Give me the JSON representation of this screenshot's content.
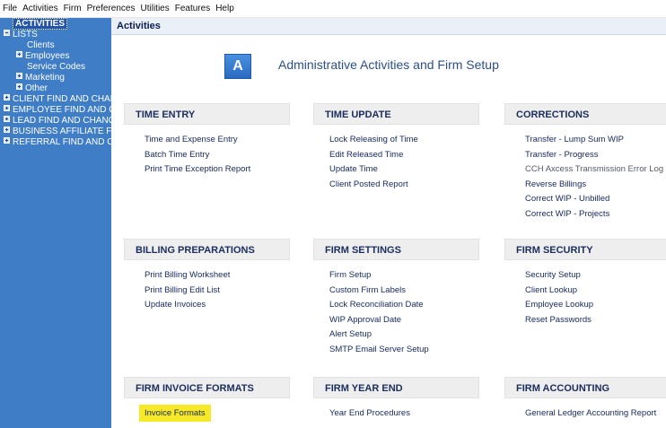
{
  "menubar": [
    "File",
    "Activities",
    "Firm",
    "Preferences",
    "Utilities",
    "Features",
    "Help"
  ],
  "sidebar": {
    "items": [
      {
        "label": "ACTIVITIES",
        "indent": 14,
        "box": "none",
        "selected": true
      },
      {
        "label": "LISTS",
        "indent": 4,
        "box": "minus"
      },
      {
        "label": "Clients",
        "indent": 30,
        "box": "none"
      },
      {
        "label": "Employees",
        "indent": 18,
        "box": "plus"
      },
      {
        "label": "Service Codes",
        "indent": 30,
        "box": "none"
      },
      {
        "label": "Marketing",
        "indent": 18,
        "box": "plus"
      },
      {
        "label": "Other",
        "indent": 18,
        "box": "plus"
      },
      {
        "label": "CLIENT FIND AND CHAN",
        "indent": 4,
        "box": "plus"
      },
      {
        "label": "EMPLOYEE FIND AND C",
        "indent": 4,
        "box": "plus"
      },
      {
        "label": "LEAD FIND AND CHANG",
        "indent": 4,
        "box": "plus"
      },
      {
        "label": "BUSINESS AFFILIATE FI",
        "indent": 4,
        "box": "plus"
      },
      {
        "label": "REFERRAL FIND AND C",
        "indent": 4,
        "box": "plus"
      }
    ]
  },
  "main": {
    "title": "Activities",
    "hero": {
      "icon_letter": "A",
      "title": "Administrative Activities and Firm Setup"
    },
    "sections": [
      {
        "title": "TIME ENTRY",
        "links": [
          {
            "label": "Time and Expense Entry"
          },
          {
            "label": "Batch Time Entry"
          },
          {
            "label": "Print Time Exception Report"
          }
        ]
      },
      {
        "title": "TIME UPDATE",
        "links": [
          {
            "label": "Lock Releasing of Time"
          },
          {
            "label": "Edit Released Time"
          },
          {
            "label": "Update Time"
          },
          {
            "label": "Client Posted Report"
          }
        ]
      },
      {
        "title": "CORRECTIONS",
        "links": [
          {
            "label": "Transfer - Lump Sum WIP"
          },
          {
            "label": "Transfer - Progress"
          },
          {
            "label": "CCH Axcess Transmission Error Log",
            "muted": true
          },
          {
            "label": "Reverse Billings"
          },
          {
            "label": "Correct WIP - Unbilled"
          },
          {
            "label": "Correct WIP - Projects"
          }
        ]
      },
      {
        "title": "BILLING PREPARATIONS",
        "links": [
          {
            "label": "Print Billing Worksheet"
          },
          {
            "label": "Print Billing Edit List"
          },
          {
            "label": "Update Invoices"
          }
        ]
      },
      {
        "title": "FIRM SETTINGS",
        "links": [
          {
            "label": "Firm Setup"
          },
          {
            "label": "Custom Firm Labels"
          },
          {
            "label": "Lock Reconciliation Date"
          },
          {
            "label": "WIP Approval Date"
          },
          {
            "label": "Alert Setup"
          },
          {
            "label": "SMTP Email Server Setup"
          }
        ]
      },
      {
        "title": "FIRM SECURITY",
        "links": [
          {
            "label": "Security Setup"
          },
          {
            "label": "Client Lookup"
          },
          {
            "label": "Employee Lookup"
          },
          {
            "label": "Reset Passwords"
          }
        ]
      },
      {
        "title": "FIRM INVOICE FORMATS",
        "links": [
          {
            "label": "Invoice Formats",
            "highlighted": true
          }
        ]
      },
      {
        "title": "FIRM YEAR END",
        "links": [
          {
            "label": "Year End Procedures"
          }
        ]
      },
      {
        "title": "FIRM ACCOUNTING",
        "links": [
          {
            "label": "General Ledger Accounting Report"
          }
        ]
      }
    ]
  },
  "colors": {
    "sidebar_bg": "#3f7dc6",
    "highlight": "#f7e928",
    "link": "#14295e"
  }
}
